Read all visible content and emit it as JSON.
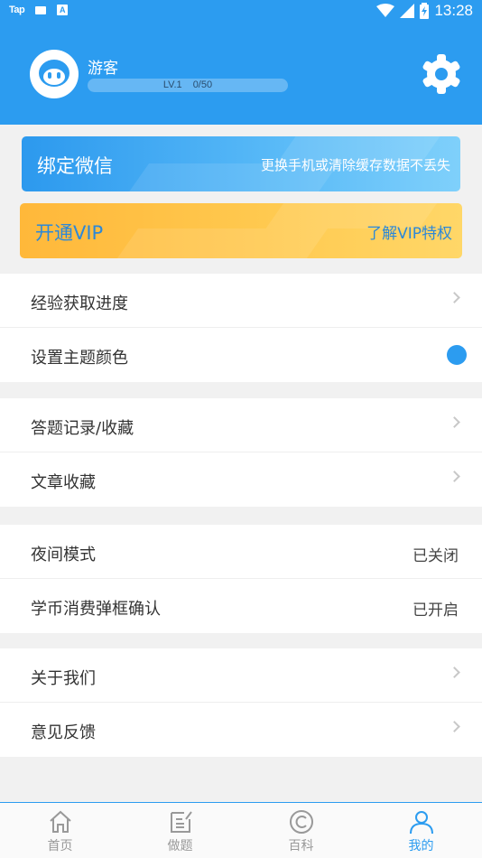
{
  "status_bar": {
    "left_icons": [
      "tap-app-icon",
      "mail-icon",
      "a-app-icon"
    ],
    "tap_text": "Tap",
    "a_text": "A",
    "right_icons": [
      "wifi-icon",
      "signal-icon",
      "battery-charging-icon"
    ],
    "time": "13:28"
  },
  "profile": {
    "name": "游客",
    "level": "LV.1",
    "progress": "0/50",
    "settings_icon": "gear-icon"
  },
  "cards": {
    "wechat": {
      "title": "绑定微信",
      "subtitle": "更换手机或清除缓存数据不丢失"
    },
    "vip": {
      "title": "开通VIP",
      "link": "了解VIP特权"
    }
  },
  "menu": {
    "group1": {
      "exp_progress": "经验获取进度",
      "theme_color": "设置主题颜色"
    },
    "group2": {
      "answer_records": "答题记录/收藏",
      "article_fav": "文章收藏"
    },
    "group3": {
      "night_mode": "夜间模式",
      "night_mode_value": "已关闭",
      "coin_confirm": "学币消费弹框确认",
      "coin_confirm_value": "已开启"
    },
    "group4": {
      "about": "关于我们",
      "feedback": "意见反馈"
    }
  },
  "tabs": [
    {
      "label": "首页",
      "icon": "home-icon"
    },
    {
      "label": "做题",
      "icon": "edit-icon"
    },
    {
      "label": "百科",
      "icon": "copyright-icon"
    },
    {
      "label": "我的",
      "icon": "user-icon"
    }
  ],
  "colors": {
    "primary": "#2c9cf0",
    "vip": "#ffc94f",
    "background": "#f1f1f1"
  }
}
